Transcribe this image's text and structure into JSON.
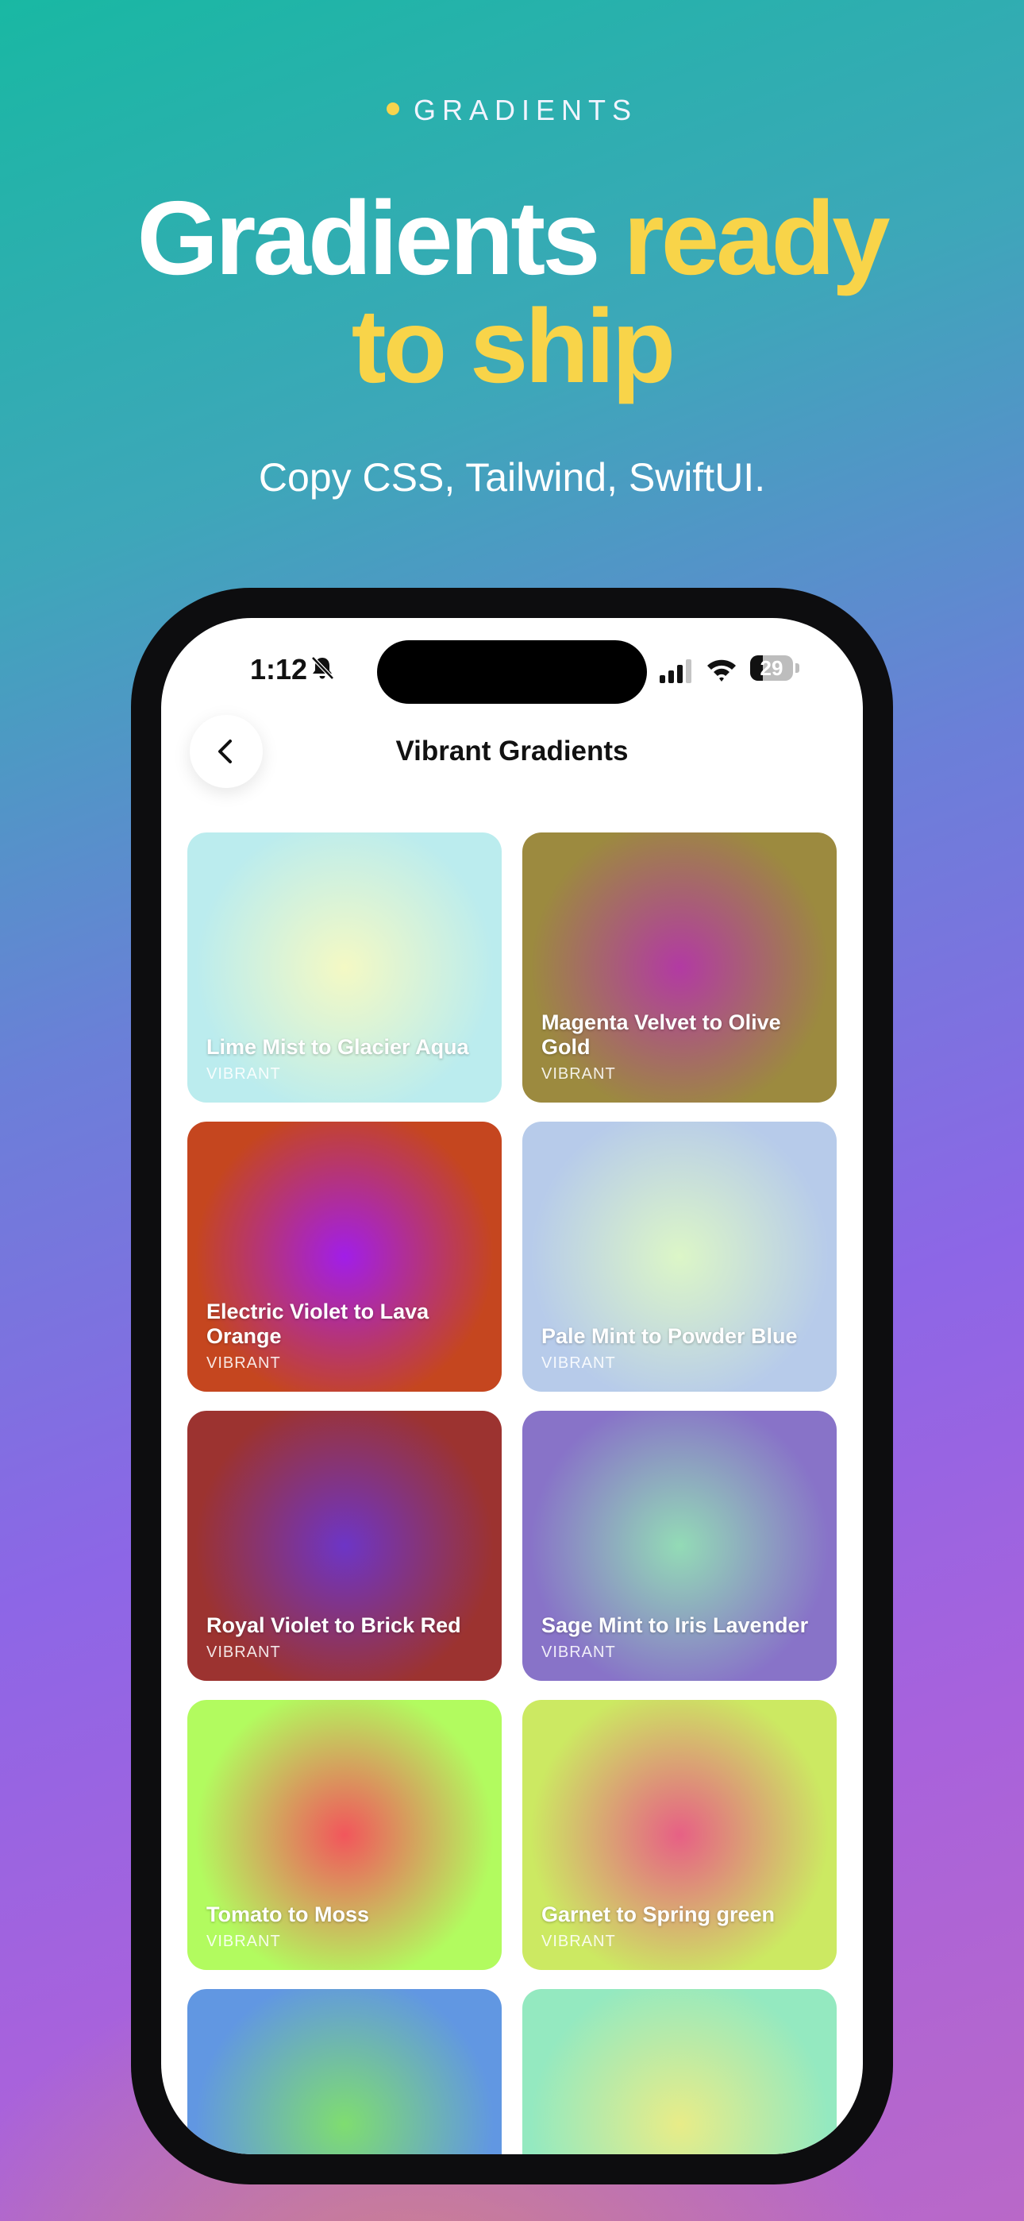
{
  "eyebrow": "GRADIENTS",
  "headline": {
    "part1": "Gradients ",
    "highlight1": "ready",
    "highlight2": "to ship"
  },
  "subhead": "Copy CSS, Tailwind, SwiftUI.",
  "colors": {
    "accent": "#f8d449",
    "phone_frame": "#0d0d0f"
  },
  "status_bar": {
    "time": "1:12",
    "battery": "29",
    "icons": [
      "bell-slash-icon",
      "signal-icon",
      "wifi-icon",
      "battery-icon"
    ]
  },
  "nav": {
    "title": "Vibrant Gradients",
    "back_icon": "chevron-left-icon"
  },
  "cards": [
    {
      "title": "Lime Mist to Glacier Aqua",
      "tag": "VIBRANT",
      "center": "#f4f9c4",
      "edge": "#bbecee"
    },
    {
      "title": "Magenta Velvet to Olive Gold",
      "tag": "VIBRANT",
      "center": "#b23aa3",
      "edge": "#9c8a3f"
    },
    {
      "title": "Electric Violet to Lava Orange",
      "tag": "VIBRANT",
      "center": "#a11ee8",
      "edge": "#c5461f"
    },
    {
      "title": "Pale Mint to Powder Blue",
      "tag": "VIBRANT",
      "center": "#dcf6c7",
      "edge": "#b7cbea"
    },
    {
      "title": "Royal Violet to Brick Red",
      "tag": "VIBRANT",
      "center": "#6d35c6",
      "edge": "#9c3330"
    },
    {
      "title": "Sage Mint to Iris Lavender",
      "tag": "VIBRANT",
      "center": "#93dbb6",
      "edge": "#8873c8"
    },
    {
      "title": "Tomato to Moss",
      "tag": "VIBRANT",
      "center": "#f2565c",
      "edge": "#b2fb5f"
    },
    {
      "title": "Garnet to Spring green",
      "tag": "VIBRANT",
      "center": "#e76085",
      "edge": "#cce962"
    },
    {
      "title": "",
      "tag": "",
      "center": "#7fdd70",
      "edge": "#6197e2"
    },
    {
      "title": "",
      "tag": "",
      "center": "#e8ec88",
      "edge": "#94e9c0"
    }
  ]
}
